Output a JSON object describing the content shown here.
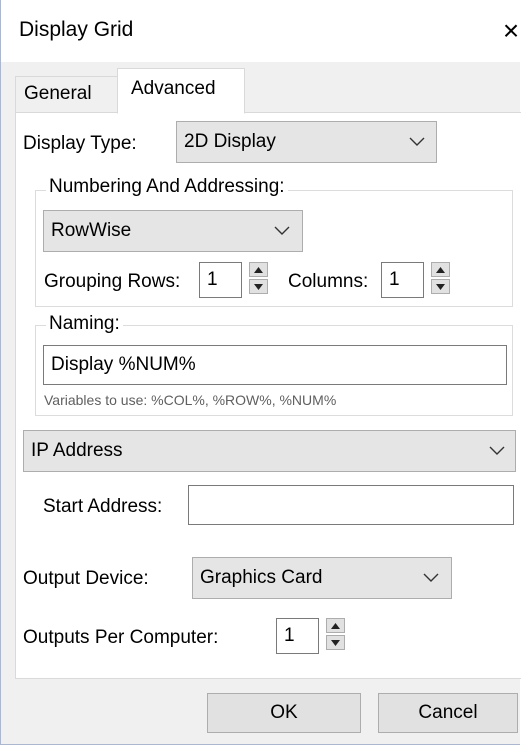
{
  "window": {
    "title": "Display Grid",
    "close_glyph": "×"
  },
  "tabs": [
    {
      "label": "General",
      "selected": false
    },
    {
      "label": "Advanced",
      "selected": true
    }
  ],
  "display_type": {
    "label": "Display Type:",
    "value": "2D Display"
  },
  "numbering": {
    "group_label": "Numbering And Addressing:",
    "mode": "RowWise",
    "grouping_rows_label": "Grouping Rows:",
    "grouping_rows_value": "1",
    "columns_label": "Columns:",
    "columns_value": "1"
  },
  "naming": {
    "group_label": "Naming:",
    "value": "Display %NUM%",
    "hint": "Variables to use: %COL%, %ROW%, %NUM%"
  },
  "address": {
    "type": "IP Address",
    "start_label": "Start Address:",
    "start_value": ""
  },
  "output_device": {
    "label": "Output Device:",
    "value": "Graphics Card"
  },
  "outputs_per_computer": {
    "label": "Outputs Per Computer:",
    "value": "1"
  },
  "buttons": {
    "ok": "OK",
    "cancel": "Cancel"
  },
  "icons": {
    "close": "close-icon",
    "dropdown": "chevron-down-icon",
    "spin_up": "arrow-up-icon",
    "spin_down": "arrow-down-icon"
  }
}
